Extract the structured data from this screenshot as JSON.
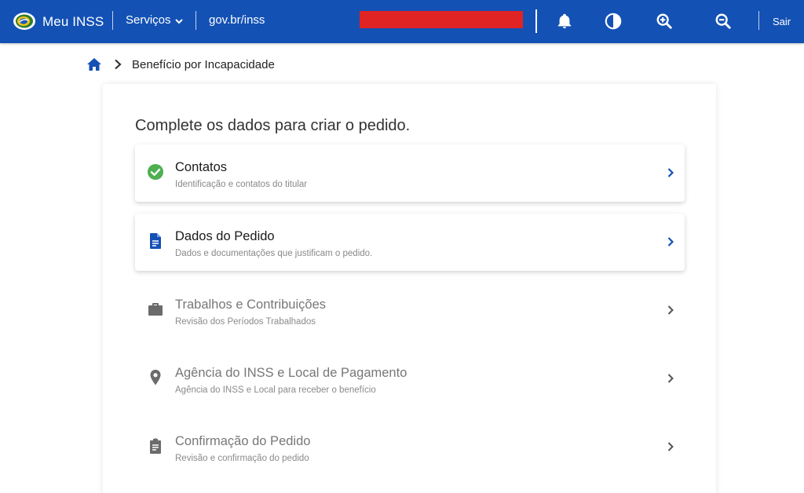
{
  "header": {
    "brand": "Meu INSS",
    "services_label": "Serviços",
    "gov_link": "gov.br/inss",
    "logout_label": "Sair",
    "color": "#1351b4",
    "icons": [
      "bell-icon",
      "contrast-icon",
      "zoom-in-icon",
      "zoom-out-icon"
    ]
  },
  "breadcrumb": {
    "home_icon": "home-icon",
    "current": "Benefício por Incapacidade"
  },
  "main": {
    "title": "Complete os dados para criar o pedido.",
    "steps": [
      {
        "title": "Contatos",
        "subtitle": "Identificação e contatos do titular",
        "icon": "check-circle-icon",
        "status": "completed"
      },
      {
        "title": "Dados do Pedido",
        "subtitle": "Dados e documentações que justificam o pedido.",
        "icon": "document-icon",
        "status": "active"
      },
      {
        "title": "Trabalhos e Contribuições",
        "subtitle": "Revisão dos Períodos Trabalhados",
        "icon": "briefcase-icon",
        "status": "pending"
      },
      {
        "title": "Agência do INSS e Local de Pagamento",
        "subtitle": "Agência do INSS e Local para receber o benefício",
        "icon": "map-pin-icon",
        "status": "pending"
      },
      {
        "title": "Confirmação do Pedido",
        "subtitle": "Revisão e confirmação do pedido",
        "icon": "clipboard-icon",
        "status": "pending"
      }
    ]
  },
  "colors": {
    "accent": "#1351b4",
    "success": "#4caf50",
    "muted_icon": "#6b6b6b"
  }
}
